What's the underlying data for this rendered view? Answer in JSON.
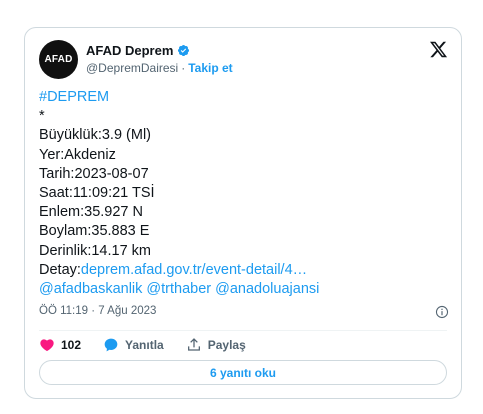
{
  "tweet": {
    "avatar_text": "AFAD",
    "display_name": "AFAD Deprem",
    "handle": "@DepremDairesi",
    "separator": "·",
    "follow_label": "Takip et",
    "hashtag": "#DEPREM",
    "lines": [
      "*",
      "Büyüklük:3.9 (Ml)",
      "Yer:Akdeniz",
      "Tarih:2023-08-07",
      "Saat:11:09:21 TSİ",
      "Enlem:35.927 N",
      "Boylam:35.883 E",
      "Derinlik:14.17 km"
    ],
    "detail_label": "Detay:",
    "detail_link": "deprem.afad.gov.tr/event-detail/4…",
    "mentions": "@afadbaskanlik @trthaber @anadoluajansi",
    "timestamp": "ÖÖ 11:19 · 7 Ağu 2023"
  },
  "actions": {
    "like_count": "102",
    "reply_label": "Yanıtla",
    "share_label": "Paylaş",
    "read_replies_label": "6 yanıtı oku"
  },
  "colors": {
    "accent": "#1d9bf0",
    "like": "#f91880",
    "text": "#0f1419",
    "muted": "#536471"
  },
  "icons": {
    "verified": "verified-badge-icon",
    "brand": "x-logo-icon",
    "info": "info-icon",
    "like": "heart-icon",
    "reply": "reply-bubble-icon",
    "share": "share-icon"
  }
}
